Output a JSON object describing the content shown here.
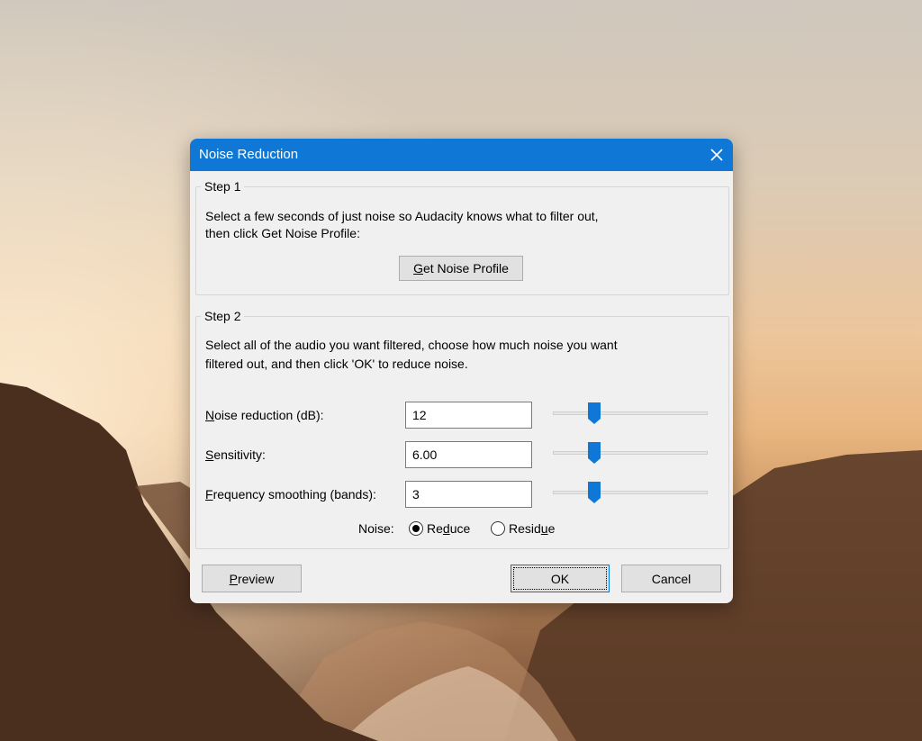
{
  "dialog": {
    "title": "Noise Reduction",
    "close_icon": "close-icon",
    "step1": {
      "legend": "Step 1",
      "instructions_line1": "Select a few seconds of just noise so Audacity knows what to filter out,",
      "instructions_line2": "then click Get Noise Profile:",
      "get_profile_button": {
        "mnemonic": "G",
        "rest": "et Noise Profile"
      }
    },
    "step2": {
      "legend": "Step 2",
      "instructions_line1": "Select all of the audio you want filtered, choose how much noise you want",
      "instructions_line2": "filtered out, and then click 'OK' to reduce noise.",
      "noise_reduction": {
        "mnemonic": "N",
        "rest": "oise reduction (dB):",
        "value": "12"
      },
      "sensitivity": {
        "mnemonic": "S",
        "rest": "ensitivity:",
        "value": "6.00"
      },
      "frequency_smoothing": {
        "mnemonic": "F",
        "rest": "requency smoothing (bands):",
        "value": "3"
      },
      "noise_label": "Noise:",
      "reduce": {
        "pre": "Re",
        "mnemonic": "d",
        "post": "uce",
        "selected": true
      },
      "residue": {
        "pre": "Resid",
        "mnemonic": "u",
        "post": "e",
        "selected": false
      }
    },
    "buttons": {
      "preview": {
        "mnemonic": "P",
        "rest": "review"
      },
      "ok": "OK",
      "cancel": "Cancel"
    }
  },
  "colors": {
    "title_bar": "#0f78d7",
    "slider_thumb": "#0f78d7",
    "dialog_bg": "#f0f0f0"
  }
}
